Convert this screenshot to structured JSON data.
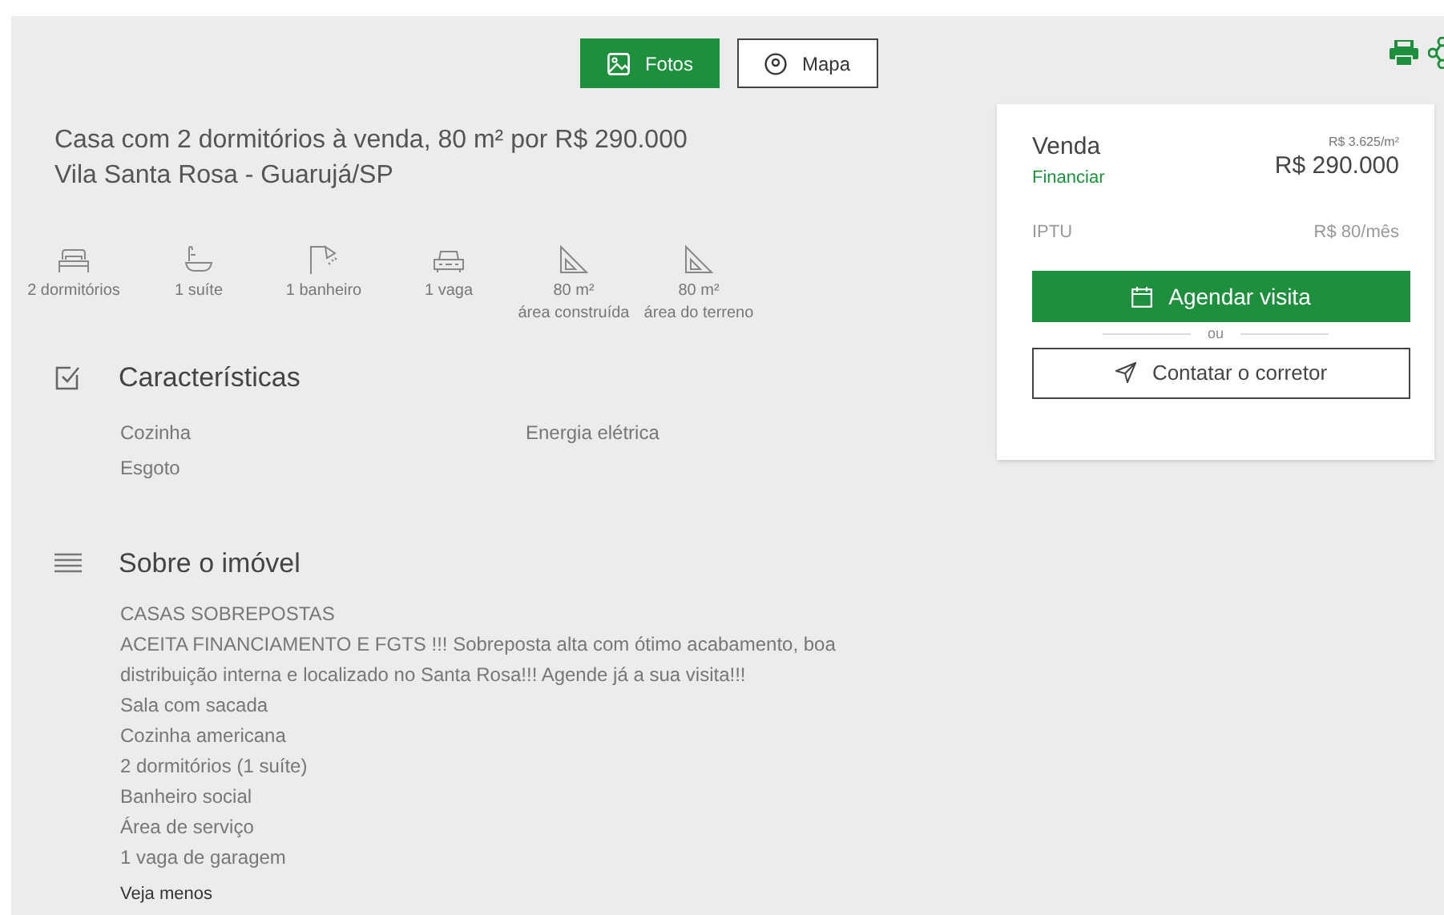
{
  "view_tabs": [
    {
      "label": "Fotos",
      "kind": "photo",
      "selected": true
    },
    {
      "label": "Mapa",
      "kind": "pin",
      "selected": false
    }
  ],
  "title": "Casa com 2 dormitórios à venda, 80 m² por R$ 290.000",
  "location": "Vila Santa Rosa - Guarujá/SP",
  "features": [
    {
      "kind": "bed",
      "label": "2 dormitórios"
    },
    {
      "kind": "bath",
      "label": "1 suíte"
    },
    {
      "kind": "shower",
      "label": "1 banheiro"
    },
    {
      "kind": "car",
      "label": "1 vaga"
    },
    {
      "kind": "area",
      "label": "80 m²",
      "sublabel": "área construída"
    },
    {
      "kind": "area",
      "label": "80 m²",
      "sublabel": "área do terreno"
    }
  ],
  "characteristics": {
    "heading": "Características",
    "items": [
      "Cozinha",
      "Energia elétrica",
      "Esgoto"
    ]
  },
  "about": {
    "heading": "Sobre o imóvel",
    "paragraphs": [
      "CASAS SOBREPOSTAS",
      "ACEITA FINANCIAMENTO E FGTS !!! Sobreposta alta com ótimo acabamento, boa distribuição interna e localizado no Santa Rosa!!! Agende já a sua visita!!!",
      "Sala com sacada",
      "Cozinha americana",
      "2 dormitórios (1 suíte)",
      "Banheiro social",
      "Área de serviço",
      "1 vaga de garagem"
    ],
    "toggle": "Veja menos"
  },
  "price_card": {
    "type": "Venda",
    "finance_link": "Financiar",
    "price_per_m2": "R$ 3.625/m²",
    "price": "R$ 290.000",
    "iptu_label": "IPTU",
    "iptu_value": "R$ 80/mês",
    "schedule_button": "Agendar visita",
    "separator": "ou",
    "contact_button": "Contatar o corretor"
  }
}
